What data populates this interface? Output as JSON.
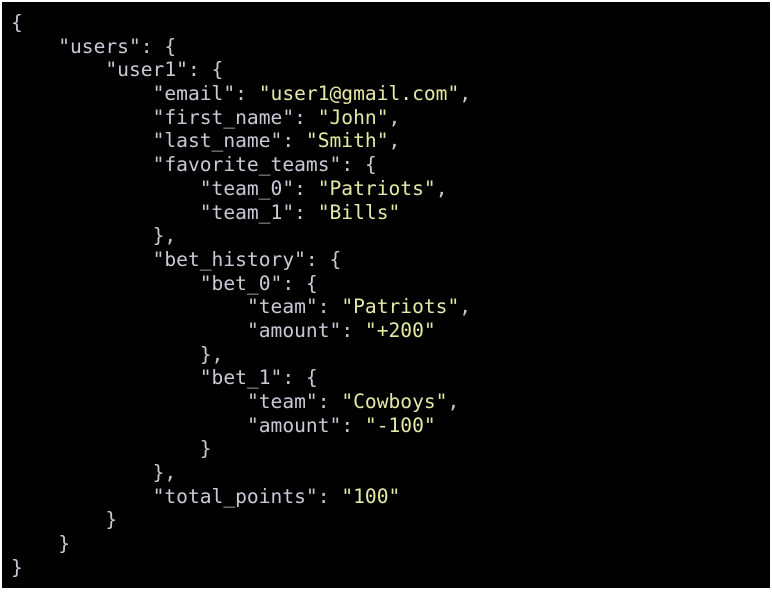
{
  "colors": {
    "background": "#000000",
    "key_and_punctuation": "#c9c9d6",
    "string_value": "#e4e9a6"
  },
  "code_lines": [
    {
      "indent": 0,
      "parts": [
        {
          "t": "p",
          "text": "{"
        }
      ]
    },
    {
      "indent": 1,
      "parts": [
        {
          "t": "k",
          "text": "\"users\""
        },
        {
          "t": "p",
          "text": ": {"
        }
      ]
    },
    {
      "indent": 2,
      "parts": [
        {
          "t": "k",
          "text": "\"user1\""
        },
        {
          "t": "p",
          "text": ": {"
        }
      ]
    },
    {
      "indent": 3,
      "parts": [
        {
          "t": "k",
          "text": "\"email\""
        },
        {
          "t": "p",
          "text": ": "
        },
        {
          "t": "v",
          "text": "\"user1@gmail.com\""
        },
        {
          "t": "p",
          "text": ","
        }
      ]
    },
    {
      "indent": 3,
      "parts": [
        {
          "t": "k",
          "text": "\"first_name\""
        },
        {
          "t": "p",
          "text": ": "
        },
        {
          "t": "v",
          "text": "\"John\""
        },
        {
          "t": "p",
          "text": ","
        }
      ]
    },
    {
      "indent": 3,
      "parts": [
        {
          "t": "k",
          "text": "\"last_name\""
        },
        {
          "t": "p",
          "text": ": "
        },
        {
          "t": "v",
          "text": "\"Smith\""
        },
        {
          "t": "p",
          "text": ","
        }
      ]
    },
    {
      "indent": 3,
      "parts": [
        {
          "t": "k",
          "text": "\"favorite_teams\""
        },
        {
          "t": "p",
          "text": ": {"
        }
      ]
    },
    {
      "indent": 4,
      "parts": [
        {
          "t": "k",
          "text": "\"team_0\""
        },
        {
          "t": "p",
          "text": ": "
        },
        {
          "t": "v",
          "text": "\"Patriots\""
        },
        {
          "t": "p",
          "text": ","
        }
      ]
    },
    {
      "indent": 4,
      "parts": [
        {
          "t": "k",
          "text": "\"team_1\""
        },
        {
          "t": "p",
          "text": ": "
        },
        {
          "t": "v",
          "text": "\"Bills\""
        }
      ]
    },
    {
      "indent": 3,
      "parts": [
        {
          "t": "p",
          "text": "},"
        }
      ]
    },
    {
      "indent": 3,
      "parts": [
        {
          "t": "k",
          "text": "\"bet_history\""
        },
        {
          "t": "p",
          "text": ": {"
        }
      ]
    },
    {
      "indent": 4,
      "parts": [
        {
          "t": "k",
          "text": "\"bet_0\""
        },
        {
          "t": "p",
          "text": ": {"
        }
      ]
    },
    {
      "indent": 5,
      "parts": [
        {
          "t": "k",
          "text": "\"team\""
        },
        {
          "t": "p",
          "text": ": "
        },
        {
          "t": "v",
          "text": "\"Patriots\""
        },
        {
          "t": "p",
          "text": ","
        }
      ]
    },
    {
      "indent": 5,
      "parts": [
        {
          "t": "k",
          "text": "\"amount\""
        },
        {
          "t": "p",
          "text": ": "
        },
        {
          "t": "v",
          "text": "\"+200\""
        }
      ]
    },
    {
      "indent": 4,
      "parts": [
        {
          "t": "p",
          "text": "},"
        }
      ]
    },
    {
      "indent": 4,
      "parts": [
        {
          "t": "k",
          "text": "\"bet_1\""
        },
        {
          "t": "p",
          "text": ": {"
        }
      ]
    },
    {
      "indent": 5,
      "parts": [
        {
          "t": "k",
          "text": "\"team\""
        },
        {
          "t": "p",
          "text": ": "
        },
        {
          "t": "v",
          "text": "\"Cowboys\""
        },
        {
          "t": "p",
          "text": ","
        }
      ]
    },
    {
      "indent": 5,
      "parts": [
        {
          "t": "k",
          "text": "\"amount\""
        },
        {
          "t": "p",
          "text": ": "
        },
        {
          "t": "v",
          "text": "\"-100\""
        }
      ]
    },
    {
      "indent": 4,
      "parts": [
        {
          "t": "p",
          "text": "}"
        }
      ]
    },
    {
      "indent": 3,
      "parts": [
        {
          "t": "p",
          "text": "},"
        }
      ]
    },
    {
      "indent": 3,
      "parts": [
        {
          "t": "k",
          "text": "\"total_points\""
        },
        {
          "t": "p",
          "text": ": "
        },
        {
          "t": "v",
          "text": "\"100\""
        }
      ]
    },
    {
      "indent": 2,
      "parts": [
        {
          "t": "p",
          "text": "}"
        }
      ]
    },
    {
      "indent": 1,
      "parts": [
        {
          "t": "p",
          "text": "}"
        }
      ]
    },
    {
      "indent": 0,
      "parts": [
        {
          "t": "p",
          "text": "}"
        }
      ]
    }
  ]
}
